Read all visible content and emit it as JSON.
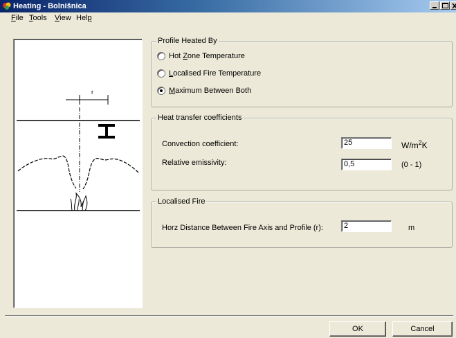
{
  "window": {
    "title": "Heating - Bolnišnica"
  },
  "menu": [
    {
      "accel": "F",
      "rest": "ile"
    },
    {
      "accel": "T",
      "rest": "ools"
    },
    {
      "accel": "V",
      "rest": "iew"
    },
    {
      "accel_pre": "Hel",
      "accel": "p",
      "rest": ""
    }
  ],
  "profile_group": {
    "title": "Profile Heated By",
    "options": [
      {
        "pre": "Hot ",
        "accel": "Z",
        "rest": "one Temperature",
        "checked": false
      },
      {
        "pre": "",
        "accel": "L",
        "rest": "ocalised Fire Temperature",
        "checked": false
      },
      {
        "pre": "",
        "accel": "M",
        "rest": "aximum Between Both",
        "checked": true
      }
    ]
  },
  "heat_group": {
    "title": "Heat transfer coefficients",
    "convection_label": "Convection coefficient:",
    "convection_value": "25",
    "convection_unit_base": "W/m",
    "convection_unit_sup": "2",
    "convection_unit_tail": "K",
    "emissivity_label": "Relative emissivity:",
    "emissivity_value": "0,5",
    "emissivity_range": "(0 - 1)"
  },
  "fire_group": {
    "title": "Localised Fire",
    "distance_label": "Horz Distance Between Fire Axis and Profile (r):",
    "distance_value": "2",
    "distance_unit": "m"
  },
  "preview": {
    "r_label": "r"
  },
  "buttons": {
    "ok": "OK",
    "cancel": "Cancel"
  }
}
